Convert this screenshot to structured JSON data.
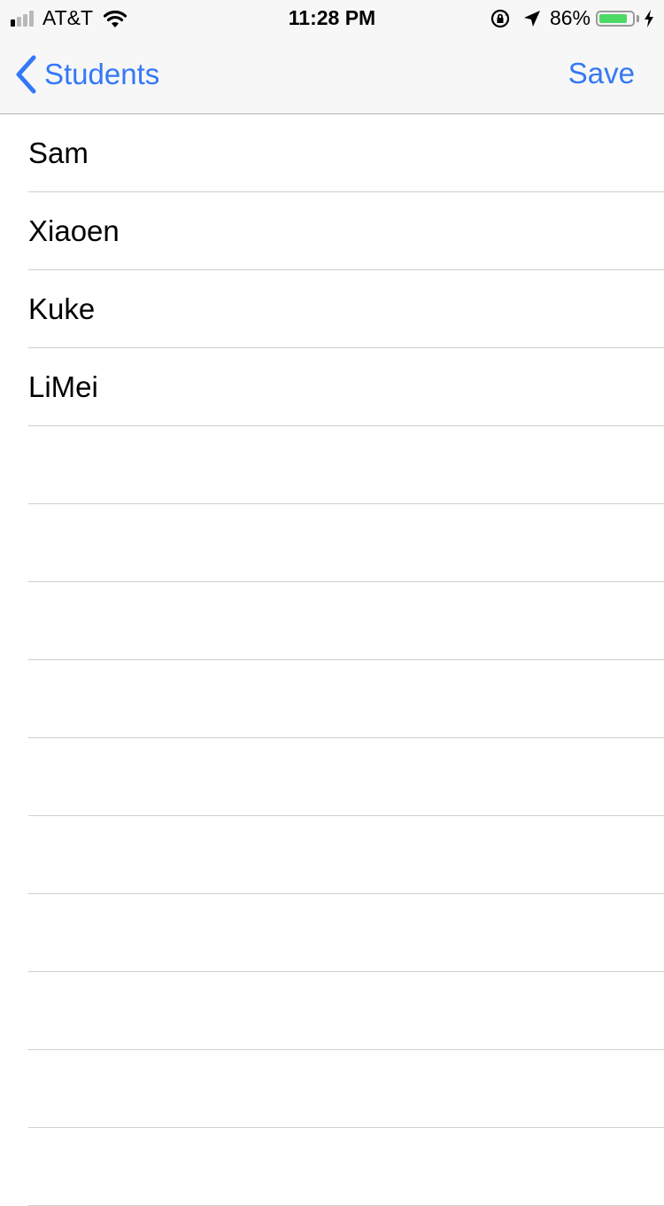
{
  "status_bar": {
    "carrier": "AT&T",
    "time": "11:28 PM",
    "battery_percent": "86%",
    "battery_level": 0.86,
    "signal_bars_active": 1,
    "signal_bars_total": 4,
    "icons": [
      "wifi-icon",
      "orientation-lock-icon",
      "location-arrow-icon",
      "charging-bolt-icon"
    ]
  },
  "nav": {
    "back_label": "Students",
    "save_label": "Save"
  },
  "colors": {
    "accent": "#3478f6",
    "battery_fill": "#4cd964",
    "separator": "#cfcfd4"
  },
  "students": [
    {
      "name": "Sam"
    },
    {
      "name": "Xiaoen"
    },
    {
      "name": "Kuke"
    },
    {
      "name": "LiMei"
    },
    {
      "name": ""
    },
    {
      "name": ""
    },
    {
      "name": ""
    },
    {
      "name": ""
    },
    {
      "name": ""
    },
    {
      "name": ""
    },
    {
      "name": ""
    },
    {
      "name": ""
    },
    {
      "name": ""
    },
    {
      "name": ""
    }
  ]
}
